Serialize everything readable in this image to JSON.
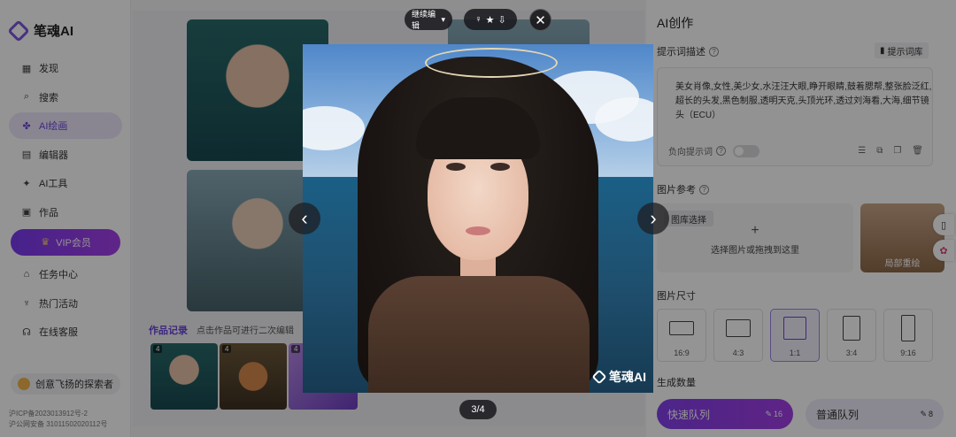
{
  "brand": {
    "name": "笔魂AI"
  },
  "sidebar": {
    "items": [
      {
        "label": "发现",
        "icon": "discover-icon"
      },
      {
        "label": "搜索",
        "icon": "search-icon"
      },
      {
        "label": "AI绘画",
        "icon": "ai-paint-icon",
        "active": true
      },
      {
        "label": "编辑器",
        "icon": "editor-icon"
      },
      {
        "label": "AI工具",
        "icon": "ai-tools-icon"
      },
      {
        "label": "作品",
        "icon": "works-icon"
      }
    ],
    "vip_label": "VIP会员",
    "items_after": [
      {
        "label": "任务中心",
        "icon": "gift-icon"
      },
      {
        "label": "热门活动",
        "icon": "event-icon"
      },
      {
        "label": "在线客服",
        "icon": "headset-icon"
      }
    ],
    "explorer_label": "创意飞扬的探索者",
    "icp_1": "沪ICP备2023013912号-2",
    "icp_2": "沪公网安备 31011502020112号"
  },
  "gallery": {
    "history_title": "作品记录",
    "history_hint": "点击作品可进行二次编辑",
    "history_items": [
      {
        "badge": "4"
      },
      {
        "badge": "4"
      },
      {
        "badge": "4"
      }
    ]
  },
  "viewer": {
    "edit_pill": "继续编辑",
    "counter": "3/4",
    "watermark": "笔魂AI"
  },
  "panel": {
    "title": "AI创作",
    "prompt_label": "提示词描述",
    "prompt_lib": "提示词库",
    "prompt_text": "美女肖像,女性,美少女,水汪汪大眼,睁开眼睛,鼓着腮帮,整张脸泛红,超长的头发,黑色制服,透明天克,头顶光环,透过刘海看,大海,细节镜头（ECU）",
    "neg_label": "负向提示词",
    "ref_label": "图片参考",
    "gallery_pick": "图库选择",
    "upload_plus": "+",
    "upload_text": "选择图片或拖拽到这里",
    "partial_label": "局部重绘",
    "size_label": "图片尺寸",
    "sizes": [
      {
        "label": "16:9"
      },
      {
        "label": "4:3"
      },
      {
        "label": "1:1",
        "active": true
      },
      {
        "label": "3:4"
      },
      {
        "label": "9:16"
      }
    ],
    "count_label": "生成数量",
    "fast_queue": "快速队列",
    "fast_count": "16",
    "normal_queue": "普通队列",
    "normal_count": "8"
  },
  "colors": {
    "accent": "#6a44d8",
    "vip_gradient": "#7a3cf0"
  }
}
